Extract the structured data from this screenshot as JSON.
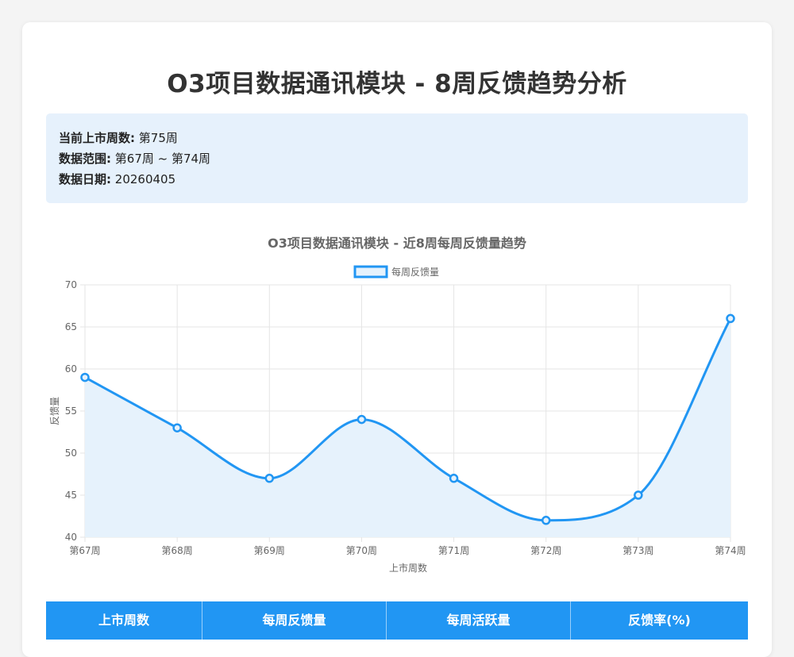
{
  "page": {
    "title": "O3项目数据通讯模块 - 8周反馈趋势分析"
  },
  "info": {
    "items": [
      {
        "label": "当前上市周数:",
        "value": "第75周"
      },
      {
        "label": "数据范围:",
        "value": "第67周 ~ 第74周"
      },
      {
        "label": "数据日期:",
        "value": "20260405"
      }
    ]
  },
  "chart_data": {
    "type": "line",
    "title": "O3项目数据通讯模块 - 近8周每周反馈量趋势",
    "xlabel": "上市周数",
    "ylabel": "反馈量",
    "categories": [
      "第67周",
      "第68周",
      "第69周",
      "第70周",
      "第71周",
      "第72周",
      "第73周",
      "第74周"
    ],
    "series": [
      {
        "name": "每周反馈量",
        "values": [
          59,
          53,
          47,
          54,
          47,
          42,
          45,
          66
        ]
      }
    ],
    "ylim": [
      40,
      70
    ],
    "yticks": [
      40,
      45,
      50,
      55,
      60,
      65,
      70
    ],
    "grid": true,
    "legend": "top-center",
    "area_fill": true,
    "colors": {
      "line": "#2196f3",
      "fill": "#e6f2fc",
      "grid": "#e5e5e5"
    }
  },
  "table": {
    "headers": [
      "上市周数",
      "每周反馈量",
      "每周活跃量",
      "反馈率(%)"
    ]
  }
}
